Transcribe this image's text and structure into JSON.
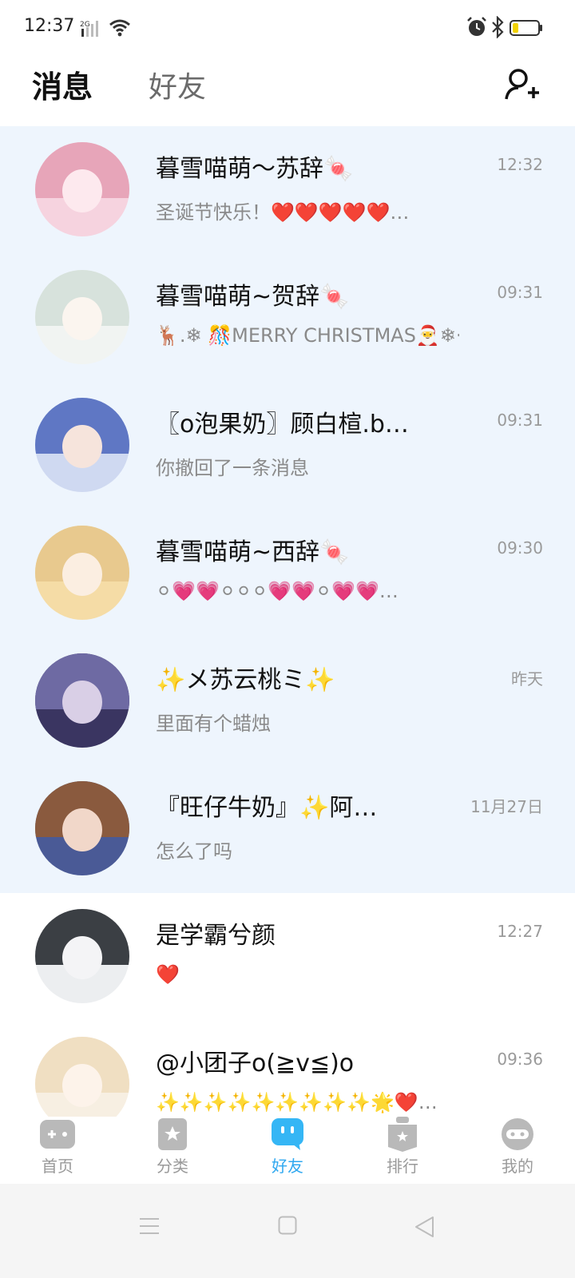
{
  "status_bar": {
    "time": "12:37",
    "network": "2G"
  },
  "header": {
    "tab_messages": "消息",
    "tab_friends": "好友",
    "add_icon": "add-friend-icon"
  },
  "conversations": [
    {
      "name": "暮雪喵萌～苏辞🍬",
      "time": "12:32",
      "message": "圣诞节快乐！❤️❤️❤️❤️❤️…",
      "pinned": true
    },
    {
      "name": "暮雪喵萌~贺辞🍬",
      "time": "09:31",
      "message": "🦌.❄ 🎊MERRY CHRISTMAS🎅❄·…",
      "pinned": true
    },
    {
      "name": "〖o泡果奶〗顾白楦.b…",
      "time": "09:31",
      "message": "你撤回了一条消息",
      "pinned": true
    },
    {
      "name": "暮雪喵萌~西辞🍬",
      "time": "09:30",
      "message": "⚪💗💗⚪⚪⚪💗💗⚪💗💗…",
      "pinned": true
    },
    {
      "name": "✨メ苏云桃ミ✨",
      "time": "昨天",
      "message": "里面有个蜡烛",
      "pinned": true
    },
    {
      "name": "『旺仔牛奶』✨阿…",
      "time": "11月27日",
      "message": "怎么了吗",
      "pinned": true
    },
    {
      "name": "是学霸兮颜",
      "time": "12:27",
      "message": "❤️",
      "pinned": false
    },
    {
      "name": "@小团子o(≧v≦)o",
      "time": "09:36",
      "message": "✨✨✨✨✨✨✨✨✨🌟❤️…",
      "pinned": false
    }
  ],
  "bottom_nav": [
    {
      "label": "首页",
      "icon": "gamepad-icon",
      "active": false
    },
    {
      "label": "分类",
      "icon": "category-icon",
      "active": false
    },
    {
      "label": "好友",
      "icon": "chat-icon",
      "active": true
    },
    {
      "label": "排行",
      "icon": "ranking-icon",
      "active": false
    },
    {
      "label": "我的",
      "icon": "profile-icon",
      "active": false
    }
  ],
  "colors": {
    "accent": "#2fa8f0",
    "pinned_bg": "#eef5fd",
    "muted_text": "#9a9a9a"
  }
}
